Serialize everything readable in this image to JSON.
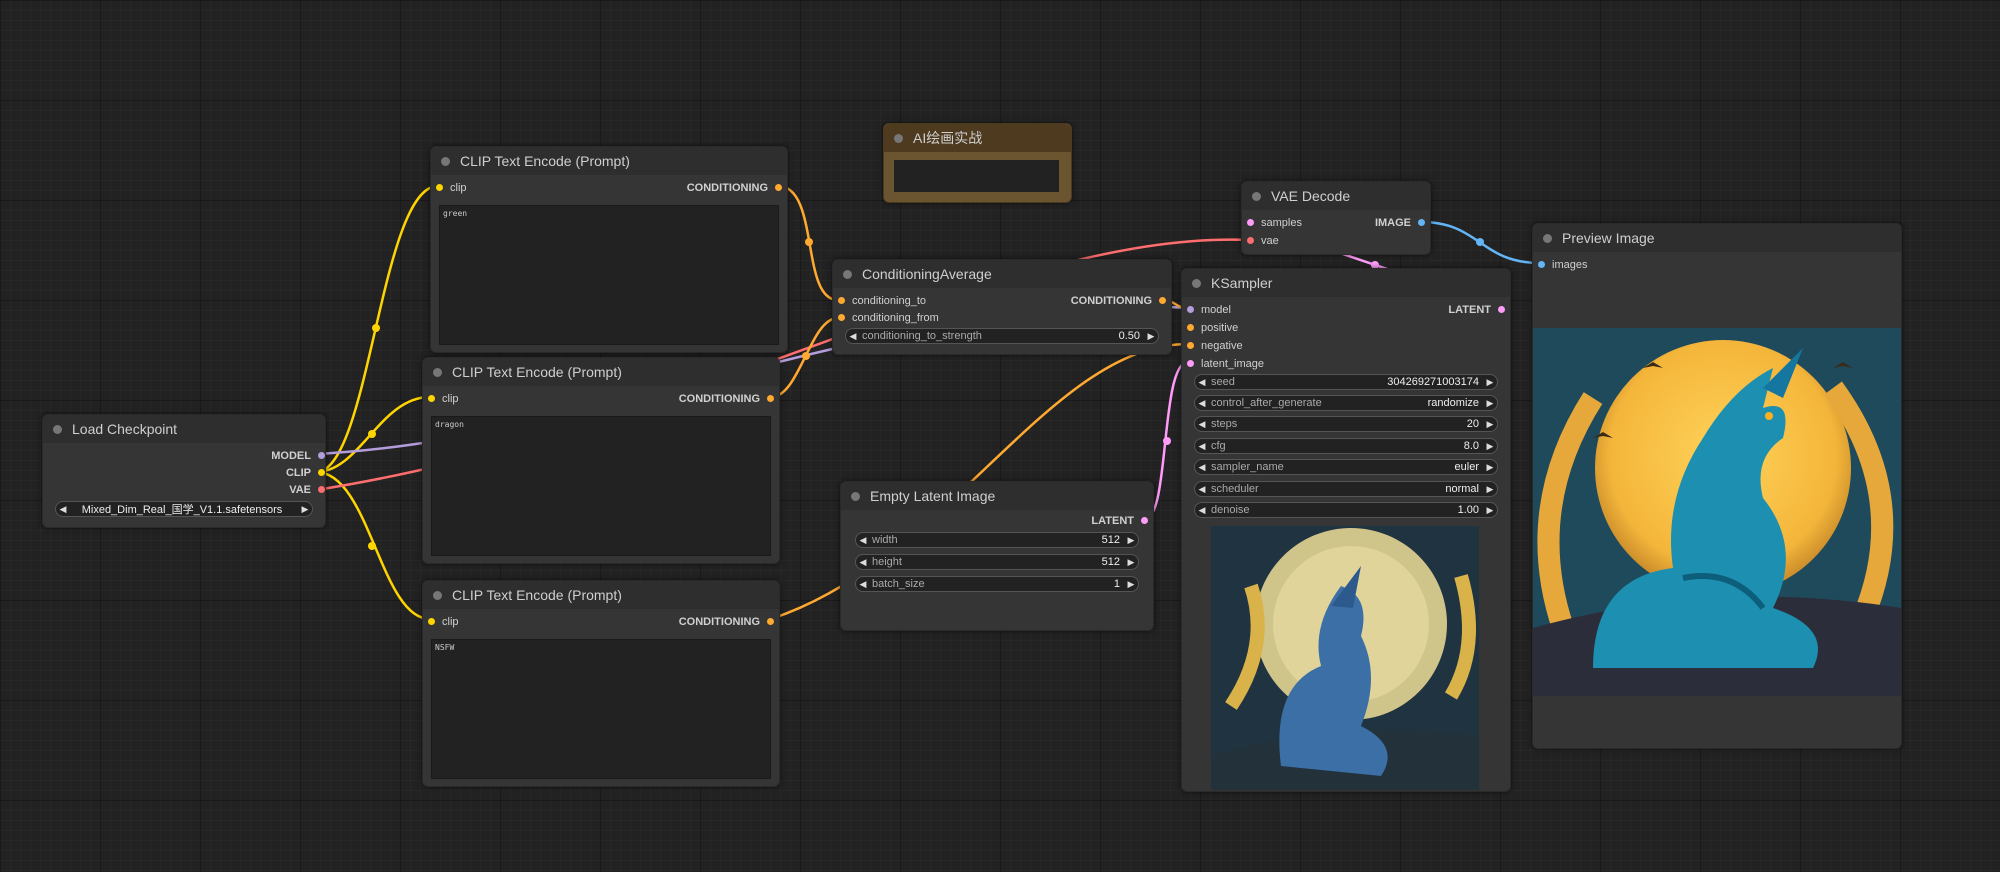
{
  "colors": {
    "clip": "#ffd500",
    "model": "#b39ddb",
    "vae": "#ff6e6e",
    "conditioning": "#ffa931",
    "latent": "#ff9cf9",
    "image": "#64b5f6"
  },
  "nodes": {
    "load_checkpoint": {
      "title": "Load Checkpoint",
      "outputs": [
        "MODEL",
        "CLIP",
        "VAE"
      ],
      "ckpt_name": "Mixed_Dim_Real_国学_V1.1.safetensors"
    },
    "clip1": {
      "title": "CLIP Text Encode (Prompt)",
      "input": "clip",
      "output": "CONDITIONING",
      "text": "green"
    },
    "clip2": {
      "title": "CLIP Text Encode (Prompt)",
      "input": "clip",
      "output": "CONDITIONING",
      "text": "dragon"
    },
    "clip3": {
      "title": "CLIP Text Encode (Prompt)",
      "input": "clip",
      "output": "CONDITIONING",
      "text": "NSFW"
    },
    "note": {
      "title": "AI绘画实战"
    },
    "cond_avg": {
      "title": "ConditioningAverage",
      "inputs": [
        "conditioning_to",
        "conditioning_from"
      ],
      "output": "CONDITIONING",
      "widget_label": "conditioning_to_strength",
      "widget_value": "0.50"
    },
    "empty_latent": {
      "title": "Empty Latent Image",
      "output": "LATENT",
      "width_label": "width",
      "width": "512",
      "height_label": "height",
      "height": "512",
      "batch_label": "batch_size",
      "batch": "1"
    },
    "vae_decode": {
      "title": "VAE Decode",
      "inputs": [
        "samples",
        "vae"
      ],
      "output": "IMAGE"
    },
    "ksampler": {
      "title": "KSampler",
      "inputs": [
        "model",
        "positive",
        "negative",
        "latent_image"
      ],
      "output": "LATENT",
      "widgets": [
        {
          "label": "seed",
          "value": "304269271003174"
        },
        {
          "label": "control_after_generate",
          "value": "randomize"
        },
        {
          "label": "steps",
          "value": "20"
        },
        {
          "label": "cfg",
          "value": "8.0"
        },
        {
          "label": "sampler_name",
          "value": "euler"
        },
        {
          "label": "scheduler",
          "value": "normal"
        },
        {
          "label": "denoise",
          "value": "1.00"
        }
      ]
    },
    "preview": {
      "title": "Preview Image",
      "input": "images"
    }
  }
}
